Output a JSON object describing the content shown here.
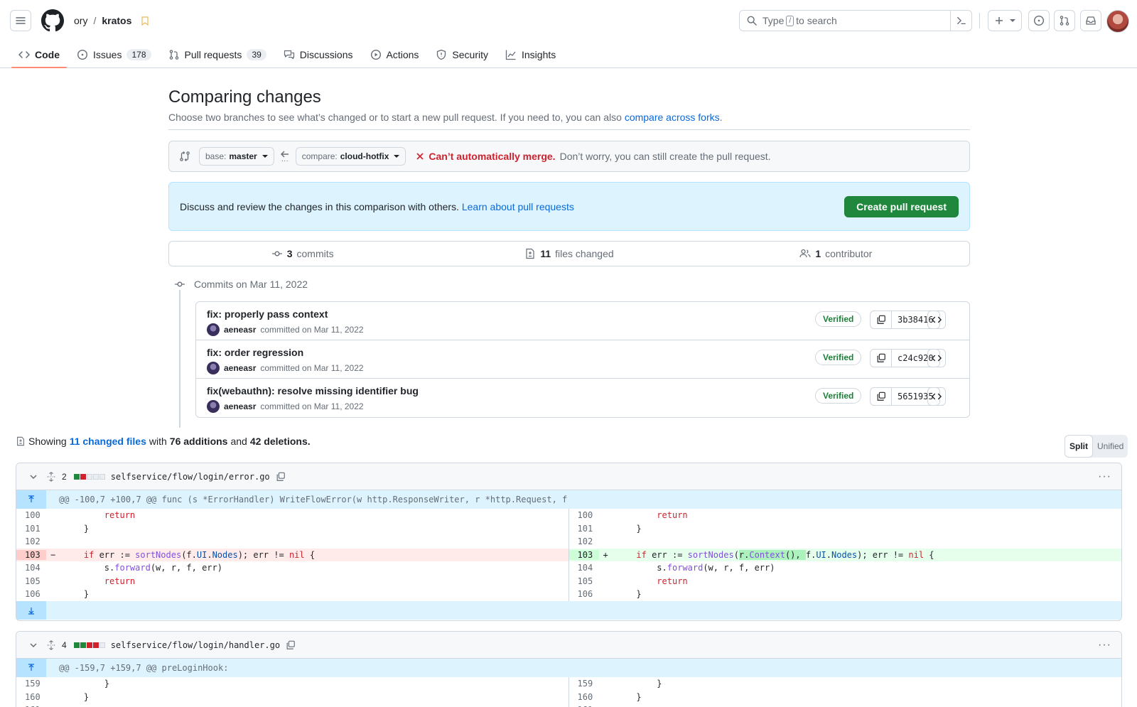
{
  "header": {
    "owner": "ory",
    "repo": "kratos",
    "search_placeholder_before": "Type",
    "search_key": "/",
    "search_placeholder_after": "to search"
  },
  "tabs": [
    {
      "label": "Code",
      "icon": "code-icon",
      "active": true
    },
    {
      "label": "Issues",
      "icon": "issue-icon",
      "count": "178"
    },
    {
      "label": "Pull requests",
      "icon": "pull-request-icon",
      "count": "39"
    },
    {
      "label": "Discussions",
      "icon": "discussions-icon"
    },
    {
      "label": "Actions",
      "icon": "play-icon"
    },
    {
      "label": "Security",
      "icon": "shield-icon"
    },
    {
      "label": "Insights",
      "icon": "graph-icon"
    }
  ],
  "compare": {
    "title": "Comparing changes",
    "subtitle": "Choose two branches to see what’s changed or to start a new pull request. If you need to, you can also",
    "subtitle_link": "compare across forks",
    "base_prefix": "base:",
    "base_branch": "master",
    "compare_prefix": "compare:",
    "compare_branch": "cloud-hotfix",
    "merge_error": "Can’t automatically merge.",
    "merge_note": "Don’t worry, you can still create the pull request."
  },
  "discuss": {
    "text": "Discuss and review the changes in this comparison with others.",
    "link": "Learn about pull requests",
    "button": "Create pull request"
  },
  "summary": {
    "commits_count": "3",
    "commits_label": "commits",
    "files_count": "11",
    "files_label": "files changed",
    "contributors_count": "1",
    "contributors_label": "contributor"
  },
  "commits_header": "Commits on Mar 11, 2022",
  "commits": [
    {
      "title": "fix: properly pass context",
      "author": "aeneasr",
      "meta": "committed on Mar 11, 2022",
      "badge": "Verified",
      "sha": "3b38416"
    },
    {
      "title": "fix: order regression",
      "author": "aeneasr",
      "meta": "committed on Mar 11, 2022",
      "badge": "Verified",
      "sha": "c24c920"
    },
    {
      "title": "fix(webauthn): resolve missing identifier bug",
      "author": "aeneasr",
      "meta": "committed on Mar 11, 2022",
      "badge": "Verified",
      "sha": "5651935"
    }
  ],
  "showing": {
    "prefix": "Showing",
    "files_link": "11 changed files",
    "with": "with",
    "additions": "76 additions",
    "and": "and",
    "deletions": "42 deletions."
  },
  "view_toggle": {
    "split": "Split",
    "unified": "Unified"
  },
  "files": [
    {
      "changes": "2",
      "path": "selfservice/flow/login/error.go",
      "hunk": "@@ -100,7 +100,7 @@ func (s *ErrorHandler) WriteFlowError(w http.ResponseWriter, r *http.Request, f"
    },
    {
      "changes": "4",
      "path": "selfservice/flow/login/handler.go",
      "hunk": "@@ -159,7 +159,7 @@ preLoginHook:"
    }
  ]
}
